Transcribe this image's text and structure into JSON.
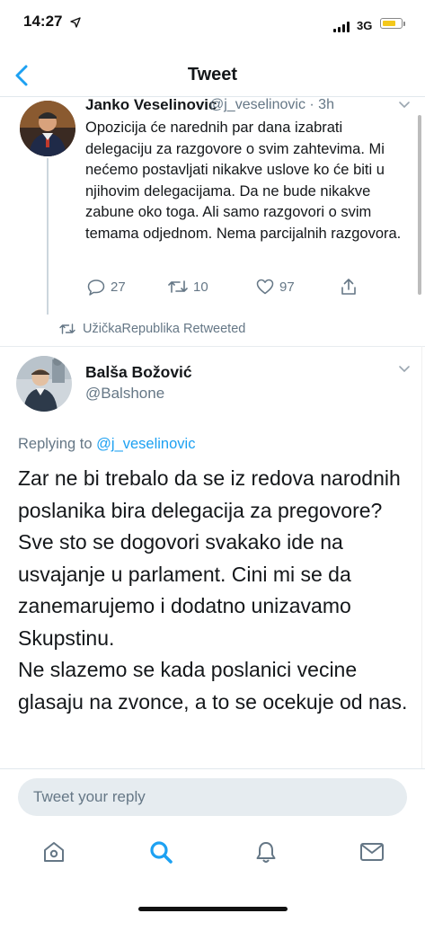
{
  "status_bar": {
    "time": "14:27",
    "network": "3G",
    "battery_level": 0.75
  },
  "nav": {
    "title": "Tweet",
    "back_icon": "chevron-left-icon"
  },
  "tweet1": {
    "author_name": "Janko Veselinovic",
    "handle_time": "@j_veselinovic · 3h",
    "text": "Opozicija će narednih par dana izabrati delegaciju za razgovore o svim zahtevima. Mi nećemo postavljati nikakve uslove ko će biti u njihovim delegacijama. Da ne bude nikakve zabune oko toga. Ali samo razgovori o svim temama odjednom. Nema parcijalnih razgovora.",
    "reply_count": "27",
    "retweet_count": "10",
    "like_count": "97"
  },
  "retweet_notice": "UžičkaRepublika Retweeted",
  "tweet2": {
    "author_name": "Balša Božović",
    "handle": "@Balshone",
    "replying_to_label": "Replying to",
    "replying_to_handle": "@j_veselinovic",
    "text": "Zar ne bi trebalo da se iz redova narodnih poslanika bira delegacija za pregovore? Sve sto se dogovori svakako ide na usvajanje u parlament. Cini mi se da zanemarujemo i dodatno unizavamo Skupstinu.\nNe slazemo se kada poslanici vecine glasaju na zvonce, a to se ocekuje od nas."
  },
  "composer": {
    "placeholder": "Tweet your reply"
  },
  "tabs": [
    "home-icon",
    "search-icon",
    "notifications-icon",
    "messages-icon"
  ],
  "colors": {
    "accent": "#1da1f2",
    "text": "#14171a",
    "secondary": "#657786",
    "battery": "#f4c81b"
  }
}
